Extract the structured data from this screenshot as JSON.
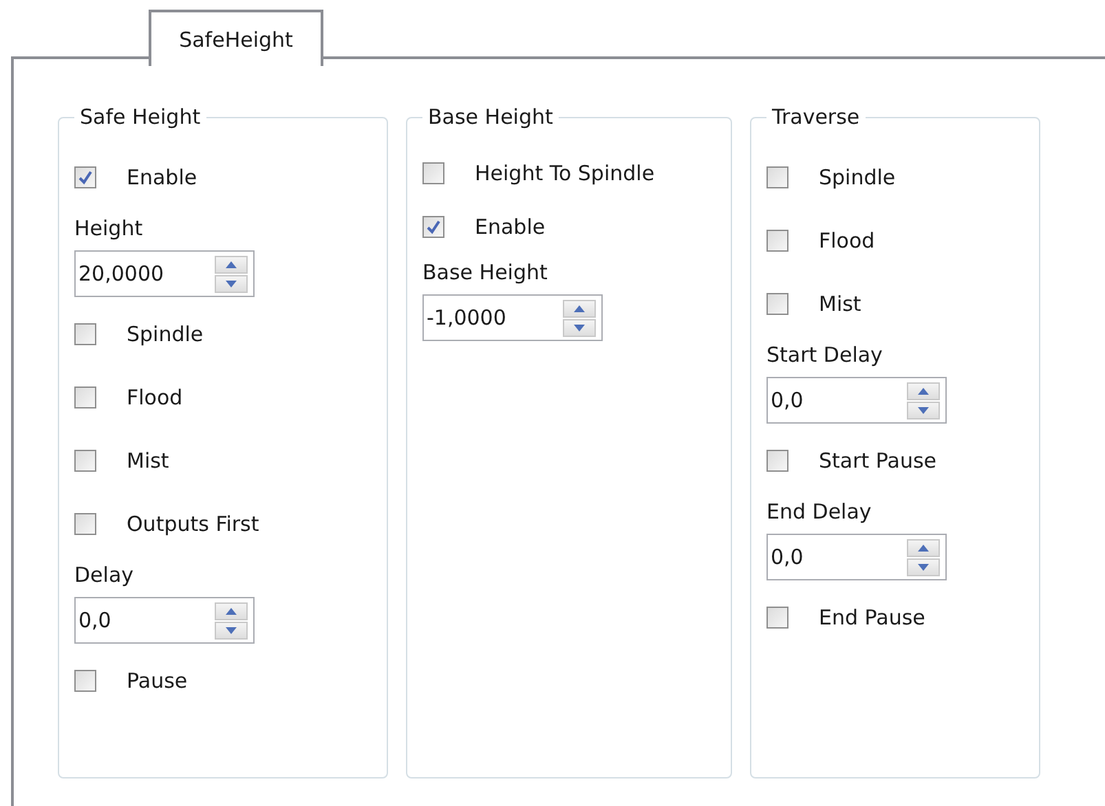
{
  "tabs": [
    {
      "label": "SafeHeight",
      "selected": true
    }
  ],
  "groups": [
    {
      "title": "Safe Height",
      "items": [
        {
          "kind": "checkbox",
          "label": "Enable",
          "checked": true
        },
        {
          "kind": "number",
          "label": "Height",
          "value": "20,0000"
        },
        {
          "kind": "checkbox",
          "label": "Spindle",
          "checked": false
        },
        {
          "kind": "checkbox",
          "label": "Flood",
          "checked": false
        },
        {
          "kind": "checkbox",
          "label": "Mist",
          "checked": false
        },
        {
          "kind": "checkbox",
          "label": "Outputs First",
          "checked": false
        },
        {
          "kind": "number",
          "label": "Delay",
          "value": "0,0"
        },
        {
          "kind": "checkbox",
          "label": "Pause",
          "checked": false
        }
      ]
    },
    {
      "title": "Base Height",
      "items": [
        {
          "kind": "checkbox",
          "label": "Height To Spindle",
          "checked": false
        },
        {
          "kind": "checkbox",
          "label": "Enable",
          "checked": true
        },
        {
          "kind": "number",
          "label": "Base Height",
          "value": "-1,0000"
        }
      ]
    },
    {
      "title": "Traverse",
      "items": [
        {
          "kind": "checkbox",
          "label": "Spindle",
          "checked": false
        },
        {
          "kind": "checkbox",
          "label": "Flood",
          "checked": false
        },
        {
          "kind": "checkbox",
          "label": "Mist",
          "checked": false
        },
        {
          "kind": "number",
          "label": "Start Delay",
          "value": "0,0"
        },
        {
          "kind": "checkbox",
          "label": "Start Pause",
          "checked": false
        },
        {
          "kind": "number",
          "label": "End Delay",
          "value": "0,0"
        },
        {
          "kind": "checkbox",
          "label": "End Pause",
          "checked": false
        }
      ]
    }
  ]
}
